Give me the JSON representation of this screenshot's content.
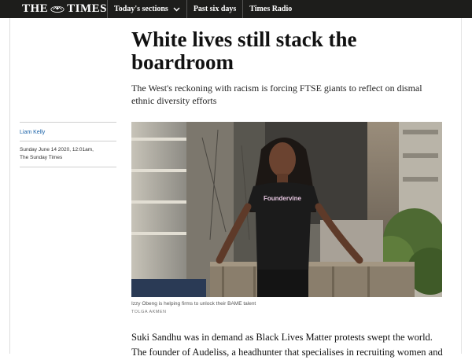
{
  "header": {
    "logo": "THE TIMES",
    "nav": [
      {
        "label": "Today's sections"
      },
      {
        "label": "Past six days"
      },
      {
        "label": "Times Radio"
      }
    ]
  },
  "article": {
    "headline": "White lives still stack the boardroom",
    "standfirst": "The West's reckoning with racism is forcing FTSE giants to reflect on dismal ethnic diversity efforts",
    "author": "Liam Kelly",
    "date": "Sunday June 14 2020, 12:01am,",
    "publication": "The Sunday Times",
    "image": {
      "shirt_text": "Foundervine",
      "caption": "Izzy Obeng is helping firms to unlock their BAME talent",
      "credit": "TOLGA AKMEN"
    },
    "body": "Suki Sandhu was in demand as Black Lives Matter protests swept the world. The founder of Audeliss, a headhunter that specialises in recruiting women and"
  }
}
